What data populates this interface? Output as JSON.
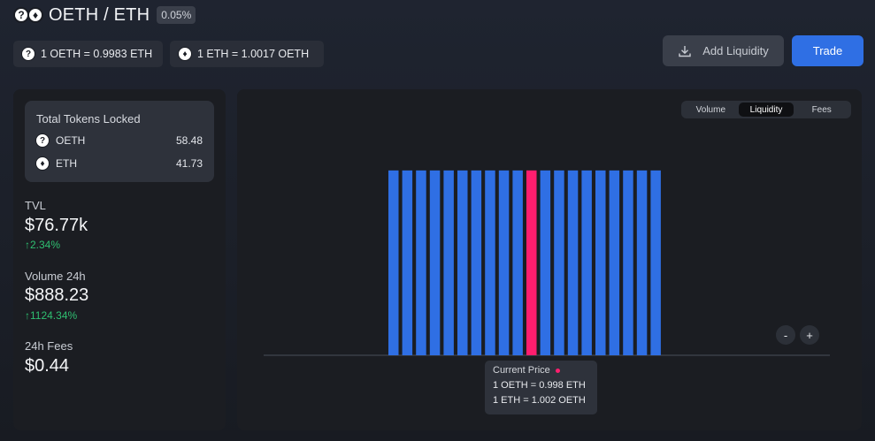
{
  "header": {
    "pair_title": "OETH / ETH",
    "fee": "0.05%"
  },
  "rates": {
    "oeth_to_eth": "1 OETH = 0.9983 ETH",
    "eth_to_oeth": "1 ETH = 1.0017 OETH"
  },
  "actions": {
    "add_liquidity_label": "Add Liquidity",
    "trade_label": "Trade"
  },
  "locked": {
    "title": "Total Tokens Locked",
    "tokens": [
      {
        "symbol": "OETH",
        "amount": "58.48"
      },
      {
        "symbol": "ETH",
        "amount": "41.73"
      }
    ]
  },
  "stats": {
    "tvl_label": "TVL",
    "tvl_value": "$76.77k",
    "tvl_change": "↑2.34%",
    "volume_label": "Volume 24h",
    "volume_value": "$888.23",
    "volume_change": "↑1124.34%",
    "fees_label": "24h Fees",
    "fees_value": "$0.44"
  },
  "chart_tabs": [
    "Volume",
    "Liquidity",
    "Fees"
  ],
  "active_tab": "Liquidity",
  "zoom": {
    "out_label": "-",
    "in_label": "+"
  },
  "tooltip": {
    "title": "Current Price",
    "line1": "1 OETH = 0.998 ETH",
    "line2": "1 ETH = 1.002 OETH"
  },
  "colors": {
    "bar": "#2f6fe4",
    "current_bar": "#ff1e6e",
    "accent": "#2f6fe4",
    "positive": "#2fbf71"
  },
  "chart_data": {
    "type": "bar",
    "title": "",
    "xlabel": "",
    "ylabel": "",
    "bar_count": 20,
    "values": [
      1,
      1,
      1,
      1,
      1,
      1,
      1,
      1,
      1,
      1,
      1,
      1,
      1,
      1,
      1,
      1,
      1,
      1,
      1,
      1
    ],
    "current_index": 11,
    "ylim": [
      0,
      1.2
    ],
    "grid": false
  }
}
